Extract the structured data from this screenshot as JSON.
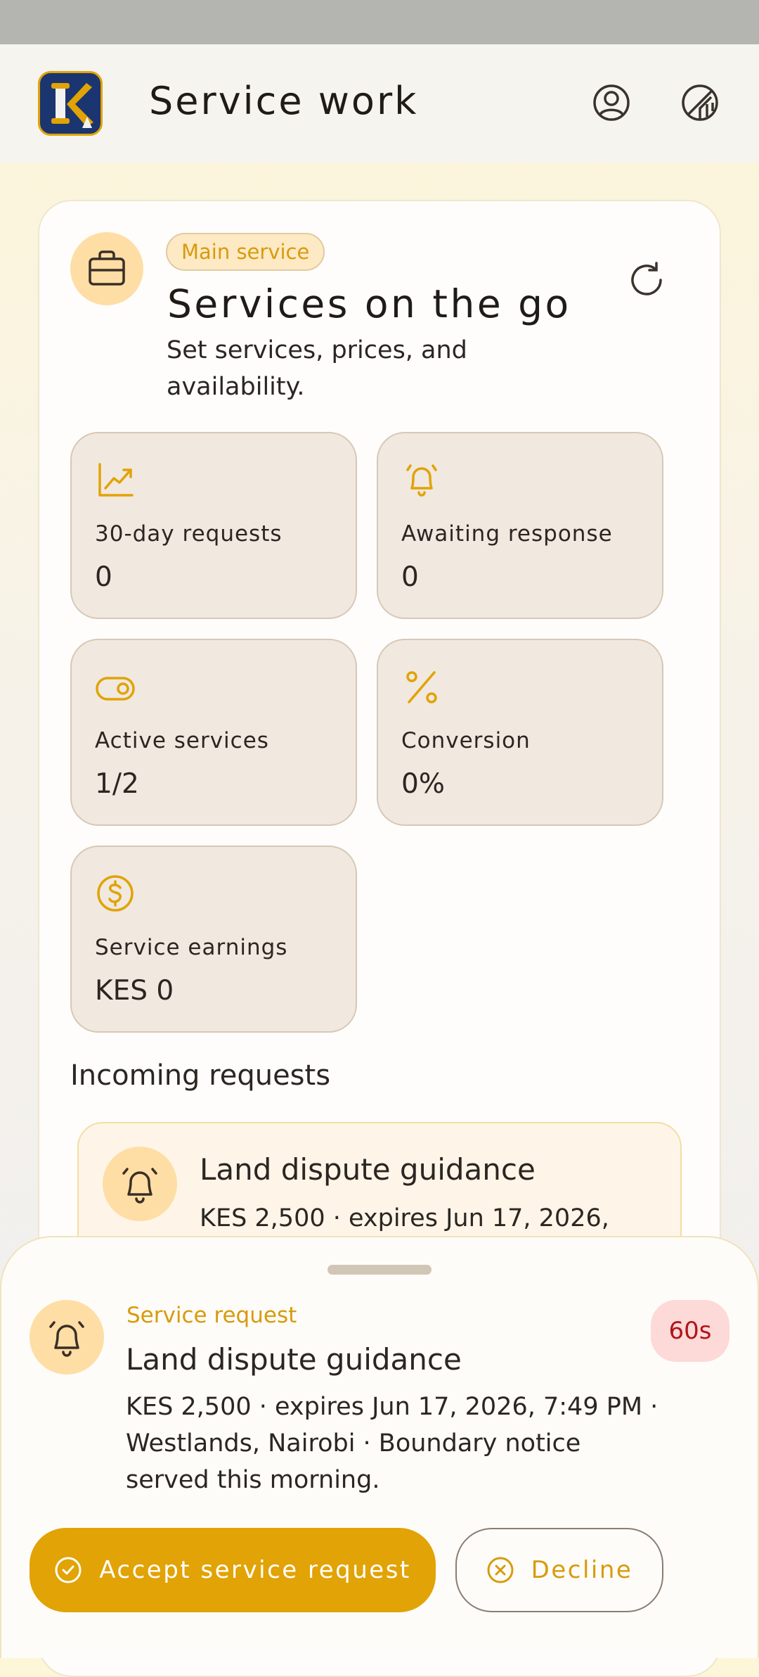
{
  "colors": {
    "accent": "#e1a305",
    "accent_text": "#d79b0d",
    "stat_bg": "#f1e8e0",
    "timer_bg": "#fdd9d8",
    "timer_text": "#b01518",
    "logo_bg": "#1b3570"
  },
  "appbar": {
    "title": "Service work",
    "logo_icon": "app-logo-k",
    "profile_icon": "user-circle-icon",
    "theme_icon": "contrast-icon"
  },
  "header": {
    "icon": "briefcase-icon",
    "chip": "Main service",
    "title": "Services on the go",
    "subtitle": "Set services, prices, and availability.",
    "refresh_icon": "refresh-icon"
  },
  "stats": [
    {
      "icon": "trend-chart-icon",
      "label": "30-day requests",
      "value": "0"
    },
    {
      "icon": "bell-ringing-icon",
      "label": "Awaiting response",
      "value": "0"
    },
    {
      "icon": "toggle-icon",
      "label": "Active services",
      "value": "1/2"
    },
    {
      "icon": "percent-icon",
      "label": "Conversion",
      "value": "0%"
    },
    {
      "icon": "dollar-coin-icon",
      "label": "Service earnings",
      "value": "KES 0"
    }
  ],
  "incoming": {
    "section_title": "Incoming requests",
    "items": [
      {
        "icon": "bell-ringing-icon",
        "title": "Land dispute guidance",
        "meta": "KES 2,500 · expires Jun 17, 2026,"
      }
    ]
  },
  "sheet": {
    "icon": "bell-ringing-icon",
    "kicker": "Service request",
    "title": "Land dispute guidance",
    "body": "KES 2,500 · expires Jun 17, 2026, 7:49 PM · Westlands, Nairobi · Boundary notice served this morning.",
    "timer": "60s",
    "accept_label": "Accept service request",
    "accept_icon": "check-circle-icon",
    "decline_label": "Decline",
    "decline_icon": "x-circle-icon"
  }
}
